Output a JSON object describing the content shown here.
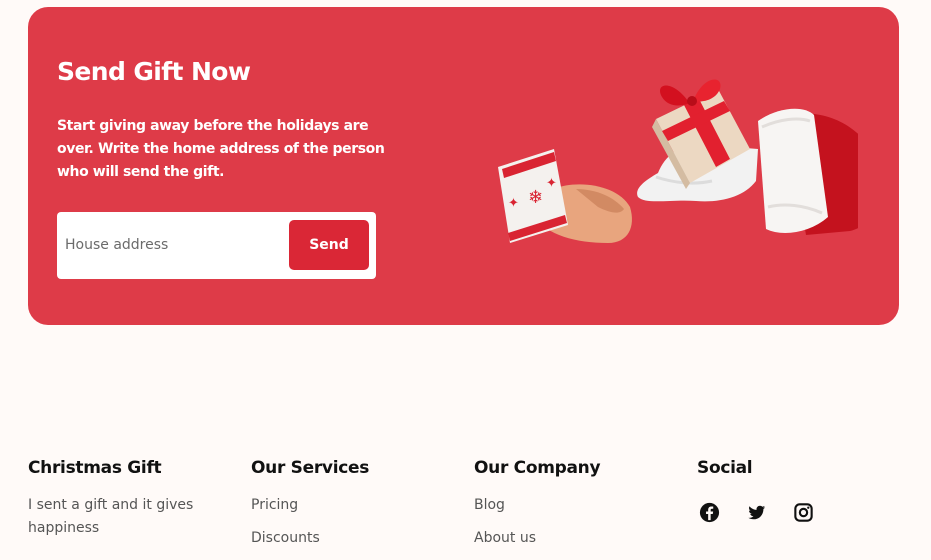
{
  "banner": {
    "title": "Send Gift Now",
    "description": "Start giving away before the holidays are over. Write the home address of the person who will send the gift.",
    "address_placeholder": "House address",
    "send_label": "Send"
  },
  "footer": {
    "brand": {
      "heading": "Christmas Gift",
      "text": "I sent a gift and it gives happiness"
    },
    "services": {
      "heading": "Our Services",
      "links": [
        "Pricing",
        "Discounts"
      ]
    },
    "company": {
      "heading": "Our Company",
      "links": [
        "Blog",
        "About us"
      ]
    },
    "social": {
      "heading": "Social",
      "icons": [
        "facebook-icon",
        "twitter-icon",
        "instagram-icon"
      ]
    }
  },
  "colors": {
    "banner_bg": "#de3b48",
    "button_bg": "#da2736",
    "page_bg": "#fffaf8"
  }
}
